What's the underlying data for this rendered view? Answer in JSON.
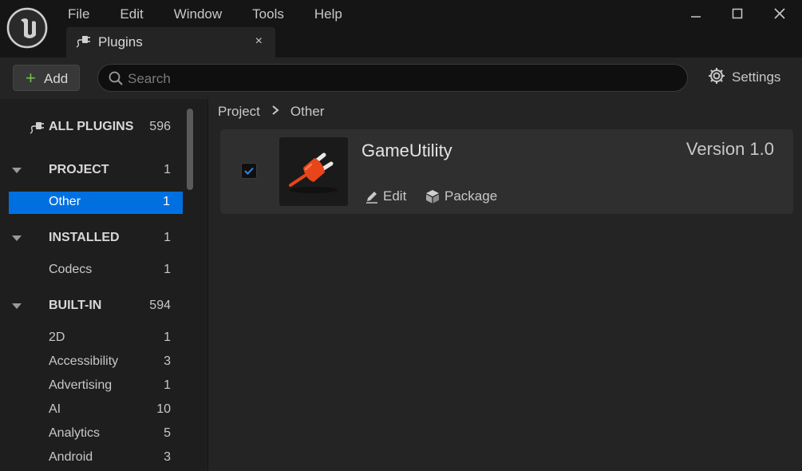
{
  "menu": [
    "File",
    "Edit",
    "Window",
    "Tools",
    "Help"
  ],
  "tab": {
    "label": "Plugins",
    "close": "×"
  },
  "toolbar": {
    "add_label": "Add",
    "search_placeholder": "Search",
    "settings_label": "Settings"
  },
  "sidebar": {
    "all": {
      "label": "ALL PLUGINS",
      "count": "596"
    },
    "project": {
      "label": "PROJECT",
      "count": "1"
    },
    "project_items": [
      {
        "label": "Other",
        "count": "1",
        "selected": true
      }
    ],
    "installed": {
      "label": "INSTALLED",
      "count": "1"
    },
    "installed_items": [
      {
        "label": "Codecs",
        "count": "1"
      }
    ],
    "builtin": {
      "label": "BUILT-IN",
      "count": "594"
    },
    "builtin_items": [
      {
        "label": "2D",
        "count": "1"
      },
      {
        "label": "Accessibility",
        "count": "3"
      },
      {
        "label": "Advertising",
        "count": "1"
      },
      {
        "label": "AI",
        "count": "10"
      },
      {
        "label": "Analytics",
        "count": "5"
      },
      {
        "label": "Android",
        "count": "3"
      }
    ]
  },
  "breadcrumb": [
    "Project",
    "Other"
  ],
  "plugin": {
    "name": "GameUtility",
    "version": "Version 1.0",
    "enabled": true,
    "edit_label": "Edit",
    "package_label": "Package"
  },
  "colors": {
    "accent": "#0070e0",
    "add_plus": "#6fc24a",
    "plug_icon": "#e8451a"
  },
  "icons": [
    "unreal-logo-icon",
    "plug-icon",
    "close-icon",
    "minimize-icon",
    "maximize-icon",
    "search-icon",
    "gear-icon",
    "pencil-icon",
    "package-icon",
    "checkmark-icon",
    "chevron-right-icon",
    "caret-down-icon"
  ]
}
